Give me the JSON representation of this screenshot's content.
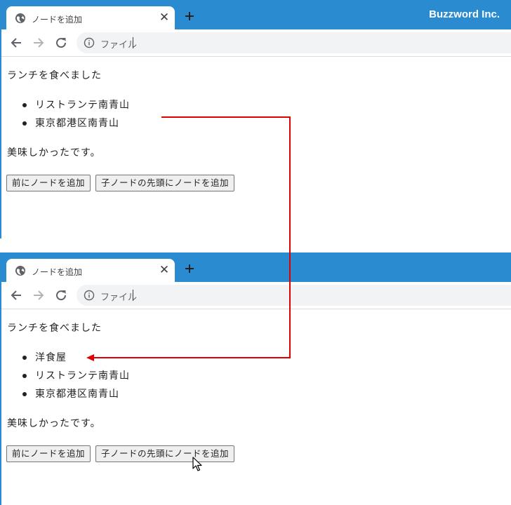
{
  "browser": {
    "tab_title": "ノードを追加",
    "brand": "Buzzword Inc.",
    "address_scheme": "ファイル",
    "icons": {
      "globe": "globe-icon",
      "close": "close-icon",
      "new_tab": "plus-icon",
      "back": "arrow-left-icon",
      "forward": "arrow-right-icon",
      "reload": "reload-icon",
      "info": "info-icon"
    },
    "colors": {
      "titlebar": "#2a8bd0",
      "arrow": "#e00000"
    }
  },
  "before": {
    "heading": "ランチを食べました",
    "items": [
      "リストランテ南青山",
      "東京都港区南青山"
    ],
    "footer": "美味しかったです。",
    "buttons": {
      "add_before": "前にノードを追加",
      "add_first_child": "子ノードの先頭にノードを追加"
    }
  },
  "after": {
    "heading": "ランチを食べました",
    "items": [
      "洋食屋",
      "リストランテ南青山",
      "東京都港区南青山"
    ],
    "footer": "美味しかったです。",
    "buttons": {
      "add_before": "前にノードを追加",
      "add_first_child": "子ノードの先頭にノードを追加"
    }
  }
}
